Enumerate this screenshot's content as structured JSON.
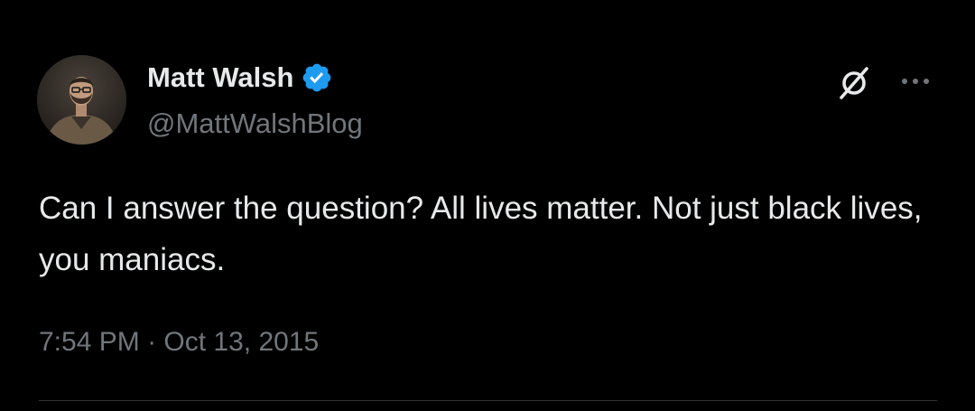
{
  "author": {
    "display_name": "Matt Walsh",
    "handle": "@MattWalshBlog",
    "verified": true,
    "verified_color": "#1d9bf0",
    "avatar": "profile-photo"
  },
  "tweet": {
    "text": "Can I answer the question? All lives matter. Not just black lives, you maniacs.",
    "time": "7:54 PM",
    "separator": "·",
    "date": "Oct 13, 2015"
  },
  "actions": {
    "grok_icon": "grok-icon",
    "more_icon": "more-icon"
  },
  "colors": {
    "background": "#000000",
    "primary_text": "#e7e9ea",
    "secondary_text": "#71767b",
    "divider": "#2f3336"
  }
}
